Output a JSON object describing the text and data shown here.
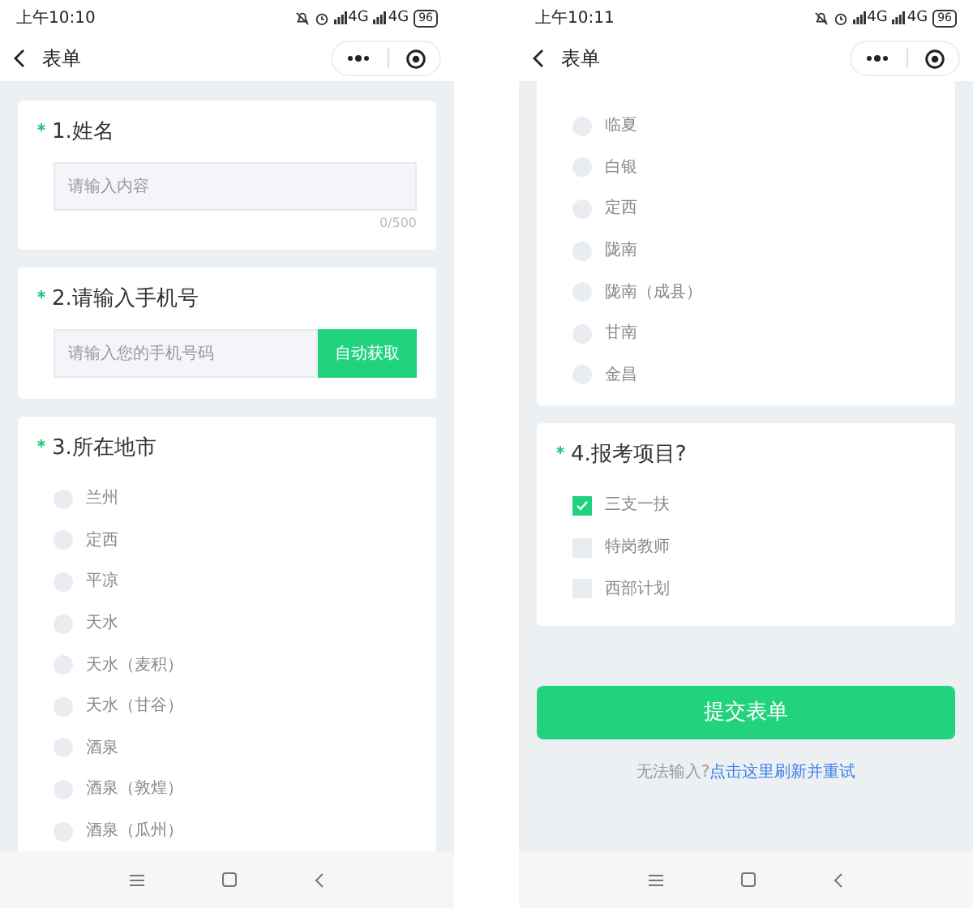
{
  "screens": [
    {
      "status": {
        "time": "上午10:10",
        "network": [
          "4G",
          "4G"
        ],
        "battery": "96"
      },
      "nav": {
        "title": "表单"
      },
      "sections": [
        {
          "kind": "text",
          "required": true,
          "title": "1.姓名",
          "placeholder": "请输入内容",
          "counter": "0/500"
        },
        {
          "kind": "phone",
          "required": true,
          "title": "2.请输入手机号",
          "placeholder": "请输入您的手机号码",
          "button": "自动获取"
        },
        {
          "kind": "radio",
          "required": true,
          "title": "3.所在地市",
          "options": [
            {
              "label": "兰州",
              "selected": false
            },
            {
              "label": "定西",
              "selected": false
            },
            {
              "label": "平凉",
              "selected": false
            },
            {
              "label": "天水",
              "selected": false
            },
            {
              "label": "天水（麦积）",
              "selected": false
            },
            {
              "label": "天水（甘谷）",
              "selected": false
            },
            {
              "label": "酒泉",
              "selected": false
            },
            {
              "label": "酒泉（敦煌）",
              "selected": false
            },
            {
              "label": "酒泉（瓜州）",
              "selected": false
            }
          ]
        }
      ]
    },
    {
      "status": {
        "time": "上午10:11",
        "network": [
          "4G",
          "4G"
        ],
        "battery": "96"
      },
      "nav": {
        "title": "表单"
      },
      "sections": [
        {
          "kind": "radio",
          "options": [
            {
              "label": "临夏",
              "selected": false
            },
            {
              "label": "白银",
              "selected": false
            },
            {
              "label": "定西",
              "selected": false
            },
            {
              "label": "陇南",
              "selected": false
            },
            {
              "label": "陇南（成县）",
              "selected": false
            },
            {
              "label": "甘南",
              "selected": false
            },
            {
              "label": "金昌",
              "selected": false
            }
          ]
        },
        {
          "kind": "checkbox",
          "required": true,
          "title": "4.报考项目?",
          "options": [
            {
              "label": "三支一扶",
              "checked": true
            },
            {
              "label": "特岗教师",
              "checked": false
            },
            {
              "label": "西部计划",
              "checked": false
            }
          ]
        }
      ],
      "submit": {
        "label": "提交表单"
      },
      "help": {
        "text": "无法输入?",
        "link": "点击这里刷新并重试"
      }
    }
  ]
}
